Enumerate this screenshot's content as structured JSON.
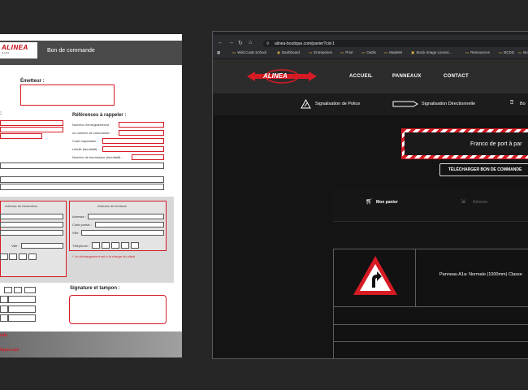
{
  "document": {
    "header_title": "Bon de commande",
    "logo_text": "ALINEA",
    "logo_sub": "S A R L",
    "emitter_label": "Émetteur :",
    "references_label": "Références à rappeler :",
    "ref_fields": [
      "Numéro d'enregistrement :",
      "ou numéro de commande :",
      "Code imputation :",
      "Libellé (facultatif) :",
      "Numéro de fournisseur (facultatif) :"
    ],
    "billing_title": "Adresse de facturation",
    "delivery_title": "Adresse de livraison",
    "delivery_fields": [
      "Adresse :",
      "Code postal :",
      "Ville :",
      "Téléphone :"
    ],
    "billing_city_label": "Ville :",
    "unloading_note": "* Le déchargement est à la charge du client",
    "signature_label": "Signature et tampon :",
    "left_red_1": "ods",
    "left_red_2": "tique.com"
  },
  "browser": {
    "address": "alinea-boutique.com/panier?cid-1",
    "bookmarks": [
      "Wild Code School",
      "Dashboard",
      "Entreprises",
      "Prior",
      "Outils",
      "Madelei",
      "Stock Image Licensi...",
      "Ressources",
      "BCDD",
      "Bo"
    ],
    "nav": {
      "logo_text": "ALINEA",
      "links": [
        "ACCUEIL",
        "PANNEAUX",
        "CONTACT"
      ]
    },
    "subnav": [
      "Signalisation de Police",
      "Signalisation Directionnelle",
      "Bo"
    ],
    "banner_text": "Franco de port à par",
    "download_button": "TÉLÉCHARGER BON DE COMMANDE",
    "steps": [
      "Mon panier",
      "Adresse"
    ],
    "product_text": "Panneau A1a: Normale (1000mm) Classe"
  },
  "colors": {
    "brand_red": "#d61b24",
    "background": "#262626",
    "site_dark": "#141414"
  }
}
